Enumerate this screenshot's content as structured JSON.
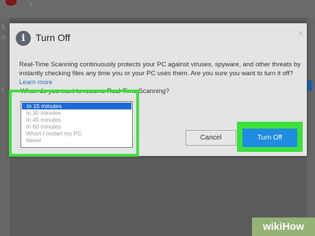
{
  "app": {
    "title_ghost": "\"y",
    "left_letters": [
      "E",
      "R",
      "L"
    ]
  },
  "dialog": {
    "title": "Turn Off",
    "icon": "info-icon",
    "close_icon": "close-icon",
    "body_text": "Real-Time Scanning continuously protects your PC against viruses, spyware, and other threats by instantly checking files any time you or your PC uses them. Are you sure you want to turn it off?",
    "learn_more": "Learn more",
    "question": "When do you want to resume Real-Time Scanning?",
    "options": [
      "In 15 minutes",
      "In 30 minutes",
      "In 45 minutes",
      "In 60 minutes",
      "When I restart my PC",
      "Never"
    ],
    "selected_option": "In 15 minutes",
    "cancel_label": "Cancel",
    "turn_off_label": "Turn Off"
  },
  "colors": {
    "accent": "#1f8ce0",
    "highlight": "#3de03d",
    "selection": "#1f6ad6",
    "link": "#2a74c9"
  },
  "watermark": {
    "text_a": "wiki",
    "text_b": "How"
  }
}
